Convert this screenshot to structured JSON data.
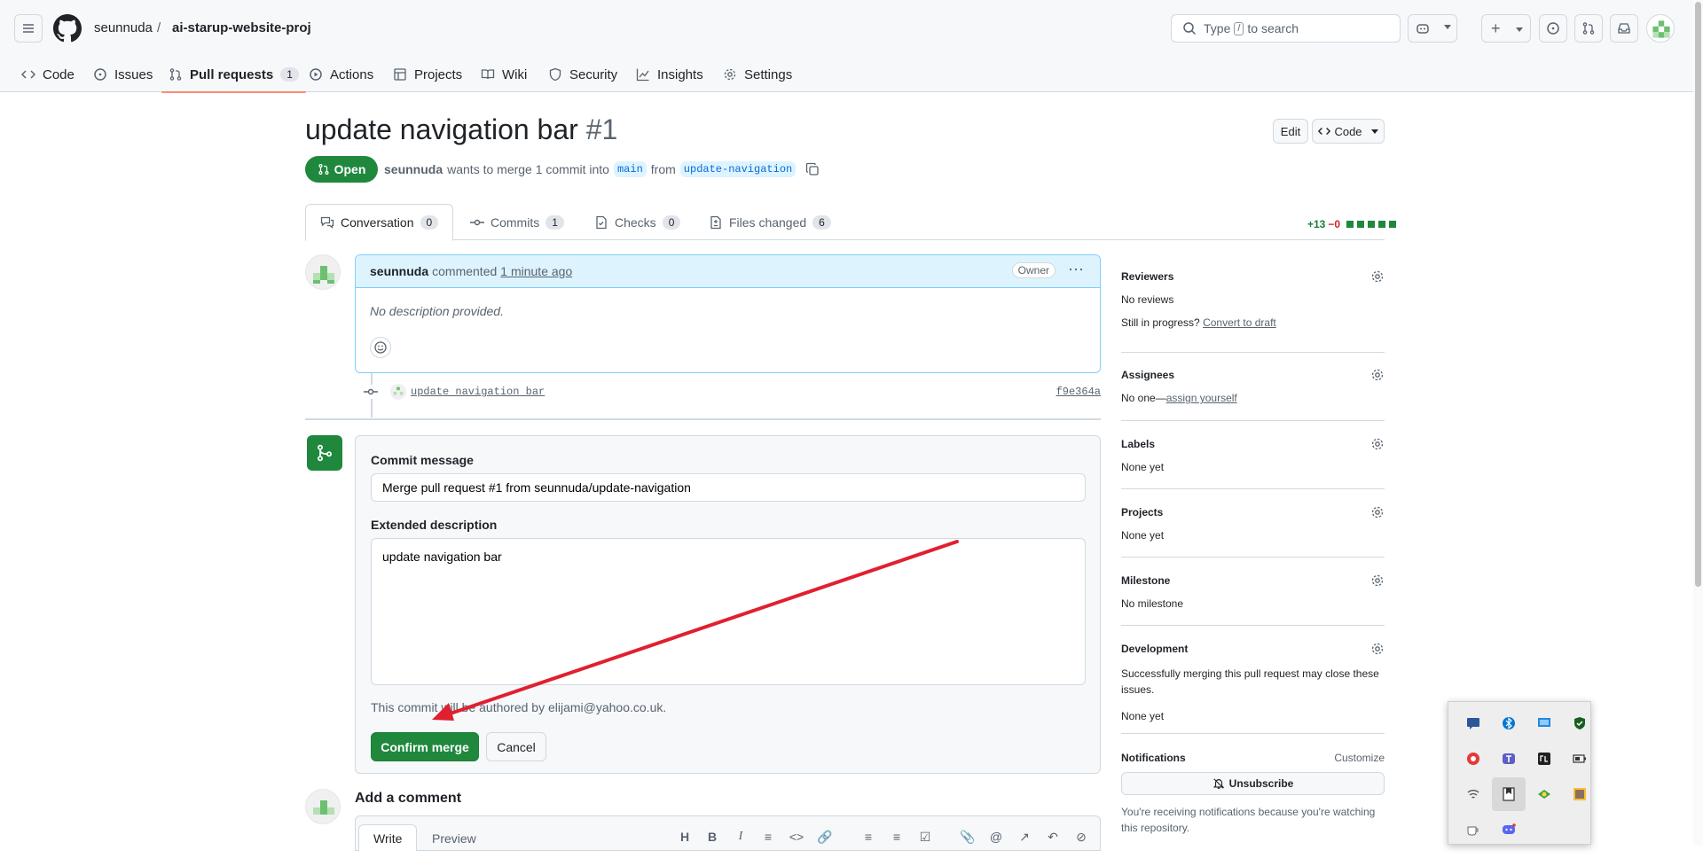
{
  "header": {
    "owner": "seunnuda",
    "separator": "/",
    "repo": "ai-starup-website-proj",
    "search_prefix": "Type",
    "search_key": "/",
    "search_suffix": "to search"
  },
  "repo_tabs": [
    {
      "label": "Code",
      "icon": "code-icon"
    },
    {
      "label": "Issues",
      "icon": "issue-icon"
    },
    {
      "label": "Pull requests",
      "icon": "pull-request-icon",
      "count": "1",
      "active": true
    },
    {
      "label": "Actions",
      "icon": "play-icon"
    },
    {
      "label": "Projects",
      "icon": "table-icon"
    },
    {
      "label": "Wiki",
      "icon": "book-icon"
    },
    {
      "label": "Security",
      "icon": "shield-icon"
    },
    {
      "label": "Insights",
      "icon": "graph-icon"
    },
    {
      "label": "Settings",
      "icon": "gear-icon"
    }
  ],
  "pr": {
    "title": "update navigation bar",
    "number": "#1",
    "edit_label": "Edit",
    "code_label": "Code",
    "state": "Open",
    "author": "seunnuda",
    "merge_text": "wants to merge 1 commit into",
    "base": "main",
    "from_text": "from",
    "head": "update-navigation"
  },
  "pr_tabs": [
    {
      "label": "Conversation",
      "count": "0"
    },
    {
      "label": "Commits",
      "count": "1"
    },
    {
      "label": "Checks",
      "count": "0"
    },
    {
      "label": "Files changed",
      "count": "6"
    }
  ],
  "diffstat": {
    "added": "+13",
    "removed": "−0"
  },
  "comment": {
    "author": "seunnuda",
    "verb": "commented",
    "time": "1 minute ago",
    "badge": "Owner",
    "body": "No description provided."
  },
  "commit": {
    "message": "update navigation bar",
    "sha": "f9e364a"
  },
  "merge": {
    "commit_message_label": "Commit message",
    "commit_message_value": "Merge pull request #1 from seunnuda/update-navigation",
    "extended_label": "Extended description",
    "extended_value": "update navigation bar",
    "author_note": "This commit will be authored by elijami@yahoo.co.uk.",
    "confirm_label": "Confirm merge",
    "cancel_label": "Cancel"
  },
  "add_comment": {
    "title": "Add a comment",
    "write_tab": "Write",
    "preview_tab": "Preview"
  },
  "sidebar": {
    "reviewers": {
      "heading": "Reviewers",
      "value": "No reviews",
      "progress_q": "Still in progress?",
      "progress_link": "Convert to draft"
    },
    "assignees": {
      "heading": "Assignees",
      "value": "No one—",
      "link": "assign yourself"
    },
    "labels": {
      "heading": "Labels",
      "value": "None yet"
    },
    "projects": {
      "heading": "Projects",
      "value": "None yet"
    },
    "milestone": {
      "heading": "Milestone",
      "value": "No milestone"
    },
    "development": {
      "heading": "Development",
      "note": "Successfully merging this pull request may close these issues.",
      "value": "None yet"
    },
    "notifications": {
      "heading": "Notifications",
      "customize": "Customize",
      "button": "Unsubscribe",
      "note": "You're receiving notifications because you're watching this repository."
    }
  },
  "colors": {
    "accent_green": "#1f883d",
    "link_blue": "#0969da",
    "tab_underline": "#fd8c73",
    "arrow_red": "#e0202f"
  }
}
